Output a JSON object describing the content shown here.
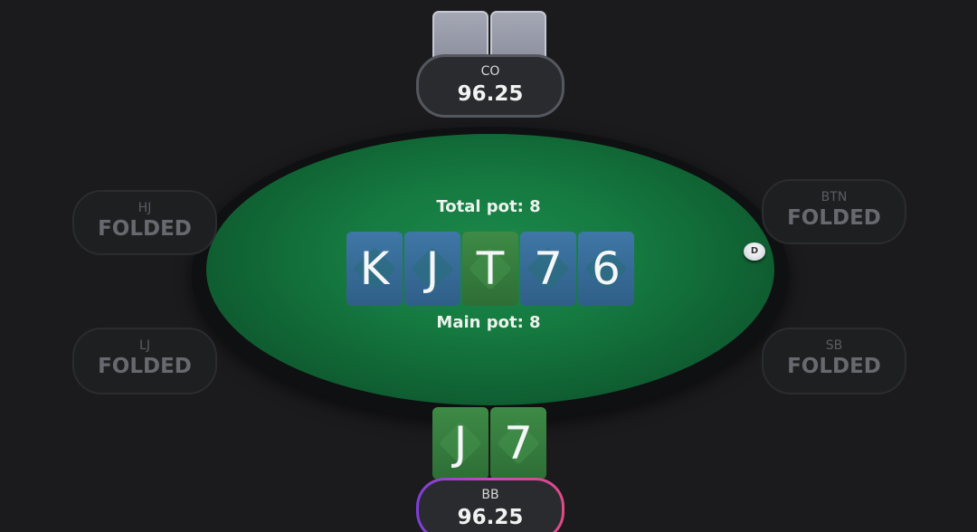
{
  "pot": {
    "total_label": "Total pot: 8",
    "main_label": "Main pot: 8"
  },
  "board": [
    {
      "rank": "K",
      "color": "blue"
    },
    {
      "rank": "J",
      "color": "blue"
    },
    {
      "rank": "T",
      "color": "green"
    },
    {
      "rank": "7",
      "color": "blue"
    },
    {
      "rank": "6",
      "color": "blue"
    }
  ],
  "hero_cards": [
    {
      "rank": "J",
      "color": "green"
    },
    {
      "rank": "7",
      "color": "green"
    }
  ],
  "seats": {
    "co": {
      "position": "CO",
      "value": "96.25"
    },
    "bb": {
      "position": "BB",
      "value": "96.25"
    },
    "hj": {
      "position": "HJ",
      "value": "FOLDED"
    },
    "lj": {
      "position": "LJ",
      "value": "FOLDED"
    },
    "btn": {
      "position": "BTN",
      "value": "FOLDED"
    },
    "sb": {
      "position": "SB",
      "value": "FOLDED"
    }
  },
  "dealer_button": {
    "label": "D"
  },
  "colors": {
    "felt": "#157a40",
    "card_blue": "#3a6f9c",
    "card_green": "#3a8242",
    "hero_ring_start": "#7c3fd8",
    "hero_ring_end": "#e04a86"
  }
}
